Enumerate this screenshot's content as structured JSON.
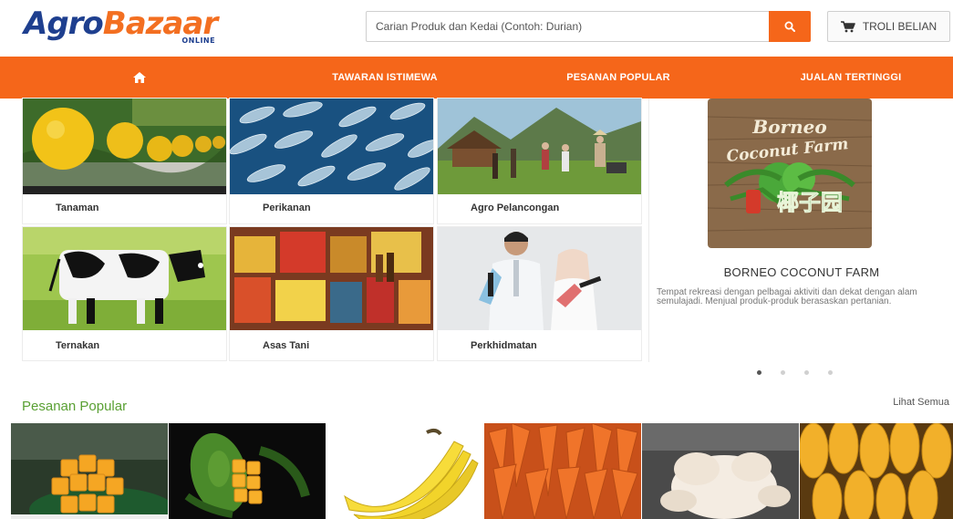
{
  "header": {
    "logo_agro": "Agro",
    "logo_bazaar": "Bazaar",
    "logo_online": "ONLINE",
    "search_placeholder": "Carian Produk dan Kedai (Contoh: Durian)",
    "search_icon": "search-icon",
    "cart_label": "TROLI BELIAN",
    "cart_icon": "cart-icon"
  },
  "nav": {
    "home_icon": "home-icon",
    "items": [
      "TAWARAN ISTIMEWA",
      "PESANAN POPULAR",
      "JUALAN TERTINGGI"
    ]
  },
  "categories": [
    {
      "label": "Tanaman",
      "icon": "melon-photo"
    },
    {
      "label": "Perikanan",
      "icon": "fish-photo"
    },
    {
      "label": "Agro Pelancongan",
      "icon": "village-photo"
    },
    {
      "label": "Ternakan",
      "icon": "cow-photo"
    },
    {
      "label": "Asas Tani",
      "icon": "products-photo"
    },
    {
      "label": "Perkhidmatan",
      "icon": "service-photo"
    }
  ],
  "featured": {
    "logo_text_1": "Borneo",
    "logo_text_2": "Coconut Farm",
    "logo_text_3": "椰子园",
    "name": "BORNEO COCONUT FARM",
    "description": "Tempat rekreasi dengan pelbagai aktiviti dan dekat dengan alam semulajadi. Menjual produk-produk berasaskan pertanian.",
    "slide_count": 4,
    "active_slide": 1
  },
  "popular": {
    "title": "Pesanan Popular",
    "see_all": "Lihat Semua",
    "products": [
      "mango-cut-photo",
      "mango-green-photo",
      "banana-photo",
      "carrot-photo",
      "chicken-photo",
      "mango-yellow-photo"
    ]
  },
  "colors": {
    "accent": "#f5661a",
    "brand_blue": "#1e3f8f",
    "section_green": "#5aa034"
  }
}
